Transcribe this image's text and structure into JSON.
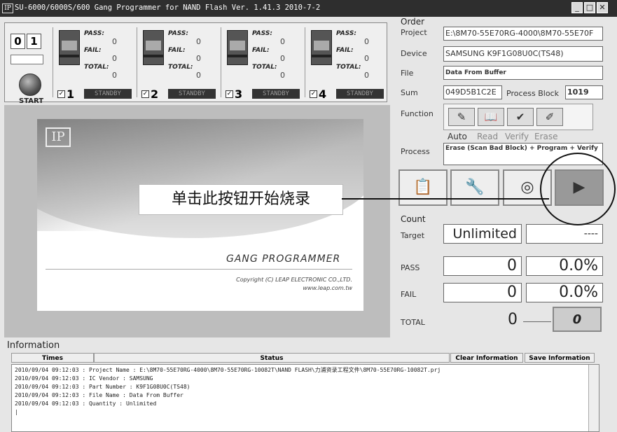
{
  "titlebar": {
    "icon_text": "IP",
    "title": "SU-6000/6000S/600 Gang Programmer for NAND Flash Ver. 1.41.3 2010-7-2",
    "minimize": "_",
    "maximize": "□",
    "close": "✕"
  },
  "control": {
    "digit1": "0",
    "digit2": "1",
    "start_label": "START"
  },
  "sites": [
    {
      "pass_label": "PASS:",
      "pass": "0",
      "fail_label": "FAIL:",
      "fail": "0",
      "total_label": "TOTAL:",
      "total": "0",
      "checked": "✓",
      "number": "1",
      "status": "STANDBY"
    },
    {
      "pass_label": "PASS:",
      "pass": "0",
      "fail_label": "FAIL:",
      "fail": "0",
      "total_label": "TOTAL:",
      "total": "0",
      "checked": "✓",
      "number": "2",
      "status": "STANDBY"
    },
    {
      "pass_label": "PASS:",
      "pass": "0",
      "fail_label": "FAIL:",
      "fail": "0",
      "total_label": "TOTAL:",
      "total": "0",
      "checked": "✓",
      "number": "3",
      "status": "STANDBY"
    },
    {
      "pass_label": "PASS:",
      "pass": "0",
      "fail_label": "FAIL:",
      "fail": "0",
      "total_label": "TOTAL:",
      "total": "0",
      "checked": "✓",
      "number": "4",
      "status": "STANDBY"
    }
  ],
  "splash": {
    "logo": "IP",
    "product": "GANG PROGRAMMER",
    "copyright": "Copyright (C)    LEAP ELECTRONIC CO.,LTD.",
    "website": "www.leap.com.tw"
  },
  "order": {
    "group_label": "Order",
    "project_label": "Project",
    "project": "E:\\8M70-55E70RG-4000\\8M70-55E70F",
    "device_label": "Device",
    "device": "SAMSUNG K9F1G08U0C(TS48)",
    "file_label": "File",
    "file": "Data From Buffer",
    "sum_label": "Sum",
    "sum": "049D5B1C2E",
    "process_block_label": "Process Block",
    "process_block": "1019",
    "function_label": "Function",
    "functions": [
      "Auto",
      "Read",
      "Verify",
      "Erase"
    ],
    "process_label": "Process",
    "process": "Erase (Scan Bad Block) + Program + Verify"
  },
  "count": {
    "group_label": "Count",
    "target_label": "Target",
    "target": "Unlimited",
    "target_extra": "----",
    "pass_label": "PASS",
    "pass": "0",
    "pass_pct": "0.0%",
    "fail_label": "FAIL",
    "fail": "0",
    "fail_pct": "0.0%",
    "total_label": "TOTAL",
    "total": "0",
    "reset_value": "0"
  },
  "information": {
    "title": "Information",
    "col_times": "Times",
    "col_status": "Status",
    "clear_button": "Clear Information",
    "save_button": "Save Information",
    "log": [
      "2010/09/04 09:12:03 : Project Name : E:\\8M70-55E70RG-4000\\8M70-55E70RG-10082T\\NAND FLASH\\力浦资录工程文件\\8M70-55E70RG-10082T.prj",
      "2010/09/04 09:12:03 : IC Vendor : SAMSUNG",
      "2010/09/04 09:12:03 : Part Number : K9F1G08U0C(TS48)",
      "2010/09/04 09:12:03 : File Name : Data From Buffer",
      "2010/09/04 09:12:03 : Quantity : Unlimited",
      "|"
    ]
  },
  "annotation": {
    "text": "单击此按钮开始烧录"
  }
}
